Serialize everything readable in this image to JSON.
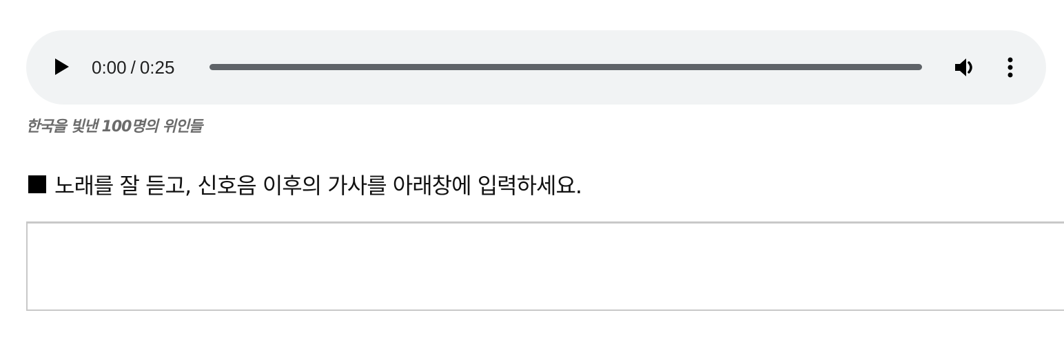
{
  "audio_player": {
    "current_time": "0:00",
    "separator": "/",
    "duration": "0:25",
    "progress": 0,
    "play_icon": "play-icon",
    "volume_icon": "volume-icon",
    "menu_icon": "more-vert-icon"
  },
  "caption": "한국을 빛낸 100명의 위인들",
  "instruction": {
    "bullet": "■",
    "text": "노래를 잘 듣고, 신호음 이후의 가사를 아래창에 입력하세요."
  },
  "answer": {
    "value": "",
    "placeholder": ""
  },
  "colors": {
    "player_background": "#f1f3f4",
    "track": "#5f6368",
    "caption": "#6b6b6b",
    "box_border": "#c8c8c8"
  }
}
